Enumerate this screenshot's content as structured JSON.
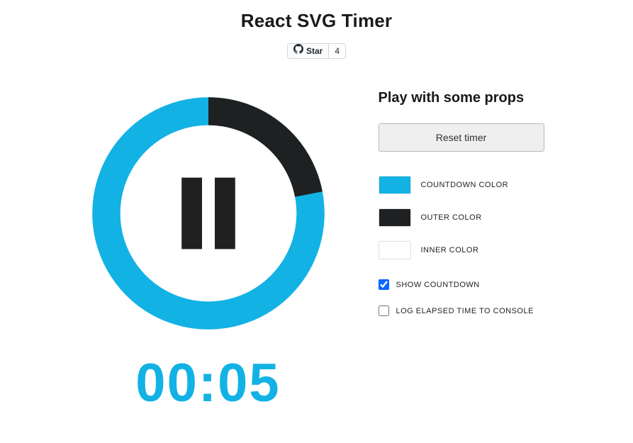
{
  "header": {
    "title": "React SVG Timer",
    "github": {
      "star_label": "Star",
      "star_count": "4"
    }
  },
  "timer": {
    "countdown_text": "00:05",
    "countdown_color": "#12b2e5",
    "outer_color": "#1f2021",
    "inner_color": "#ffffff",
    "progress_fraction": 0.22,
    "icon": "pause"
  },
  "props_panel": {
    "heading": "Play with some props",
    "reset_label": "Reset timer",
    "colors": {
      "countdown": {
        "label": "COUNTDOWN COLOR",
        "value": "#12b2e5"
      },
      "outer": {
        "label": "OUTER COLOR",
        "value": "#1f2021"
      },
      "inner": {
        "label": "INNER COLOR",
        "value": "#ffffff"
      }
    },
    "checks": {
      "show_countdown": {
        "label": "SHOW COUNTDOWN",
        "checked": true
      },
      "log_elapsed": {
        "label": "LOG ELAPSED TIME TO CONSOLE",
        "checked": false
      }
    }
  }
}
